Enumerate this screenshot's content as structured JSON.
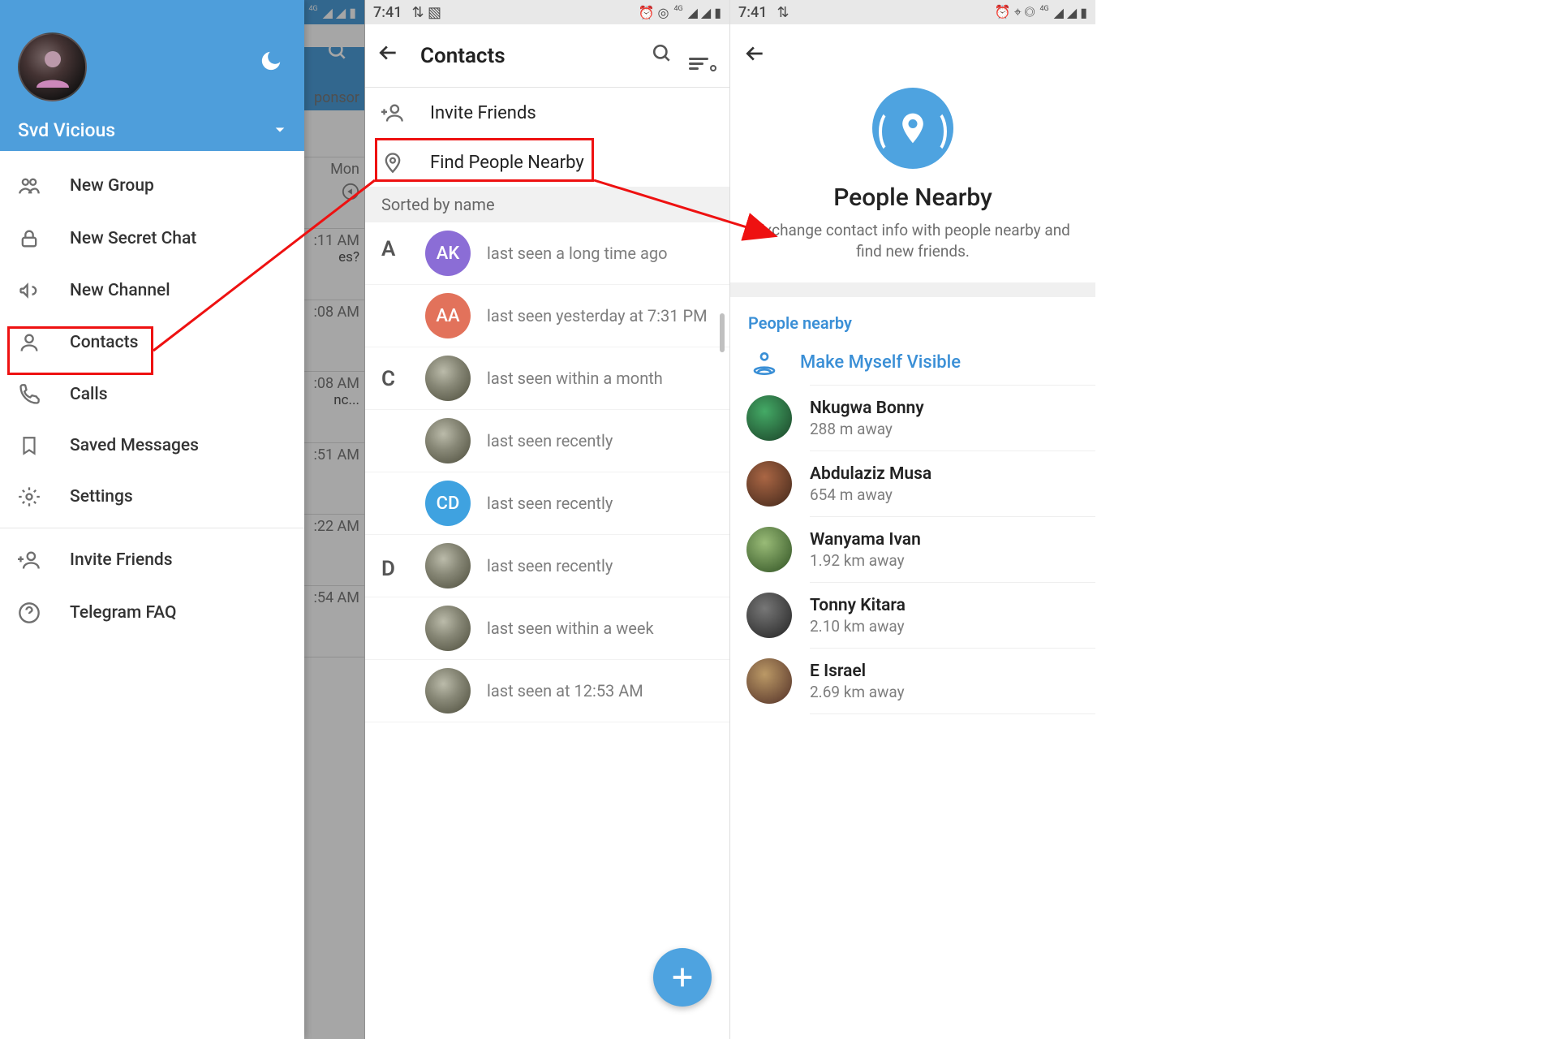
{
  "screen1": {
    "status": {
      "time": "",
      "icons": "⏰ ◎ ⁴ᴳ ◢ ◢ ▮"
    },
    "username": "Svd Vicious",
    "menu": {
      "new_group": "New Group",
      "new_secret_chat": "New Secret Chat",
      "new_channel": "New Channel",
      "contacts": "Contacts",
      "calls": "Calls",
      "saved_messages": "Saved Messages",
      "settings": "Settings",
      "invite_friends": "Invite Friends",
      "telegram_faq": "Telegram FAQ"
    },
    "peek": {
      "sponsor": "ponsor",
      "mon": "Mon",
      "t1": ":11 AM",
      "q1": "es?",
      "t2": ":08 AM",
      "t3": ":08 AM",
      "t3b": "nc...",
      "t4": ":51 AM",
      "t5": ":22 AM",
      "t6": ":54 AM"
    }
  },
  "screen2": {
    "status": {
      "time": "7:41",
      "icons": "⏰ ◎ ⁴ᴳ ◢ ◢ ▮"
    },
    "title": "Contacts",
    "invite": "Invite Friends",
    "find_nearby": "Find People Nearby",
    "sorted_by": "Sorted by name",
    "letters": {
      "a": "A",
      "c": "C",
      "d": "D"
    },
    "contacts": [
      {
        "initials": "AK",
        "color": "#8b6dd6",
        "status": "last seen a long time ago"
      },
      {
        "initials": "AA",
        "color": "#e2725b",
        "status": "last seen yesterday at 7:31 PM"
      },
      {
        "initials": "",
        "color": "#bca",
        "status": "last seen within a month"
      },
      {
        "initials": "",
        "color": "#889",
        "status": "last seen recently"
      },
      {
        "initials": "CD",
        "color": "#3fa2e0",
        "status": "last seen recently"
      },
      {
        "initials": "",
        "color": "#9ab",
        "status": "last seen recently"
      },
      {
        "initials": "",
        "color": "#786",
        "status": "last seen within a week"
      },
      {
        "initials": "",
        "color": "#cba",
        "status": "last seen at 12:53 AM"
      }
    ]
  },
  "screen3": {
    "status": {
      "time": "7:41",
      "icons": "⏰ ⌖ ◎ ⁴ᴳ ◢ ◢ ▮"
    },
    "hero_title": "People Nearby",
    "hero_sub": "Exchange contact info with people nearby and find new friends.",
    "section": "People nearby",
    "make_visible": "Make Myself Visible",
    "people": [
      {
        "name": "Nkugwa Bonny",
        "dist": "288 m away"
      },
      {
        "name": "Abdulaziz Musa",
        "dist": "654 m away"
      },
      {
        "name": "Wanyama Ivan",
        "dist": "1.92 km away"
      },
      {
        "name": "Tonny Kitara",
        "dist": "2.10 km away"
      },
      {
        "name": "E Israel",
        "dist": "2.69 km away"
      }
    ]
  }
}
